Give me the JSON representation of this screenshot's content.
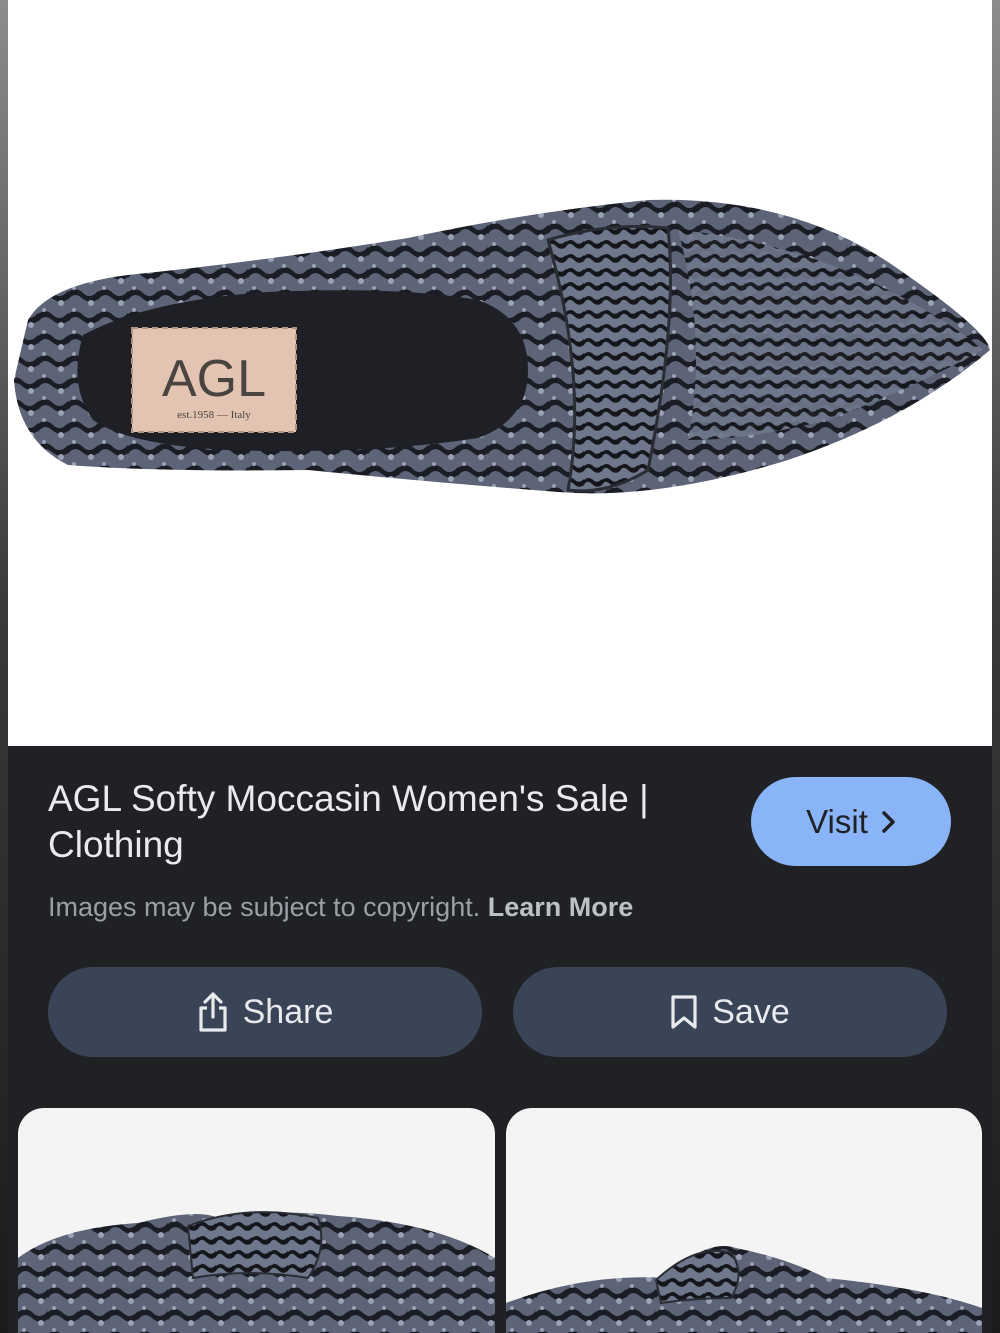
{
  "result": {
    "title": "AGL Softy Moccasin Women's Sale | Clothing",
    "visit_label": "Visit",
    "copyright_text": "Images may be subject to copyright.",
    "learn_more_label": "Learn More"
  },
  "insole_brand": "AGL",
  "insole_tagline": "est.1958 — Italy",
  "actions": {
    "share_label": "Share",
    "save_label": "Save"
  },
  "icons": [
    "chevron-right-icon",
    "share-icon",
    "bookmark-icon"
  ],
  "colors": {
    "background": "#202124",
    "visit_button": "#8ab4f8",
    "action_button": "#394457",
    "title_text": "#e8eaed",
    "secondary_text": "#9aa0a6"
  }
}
